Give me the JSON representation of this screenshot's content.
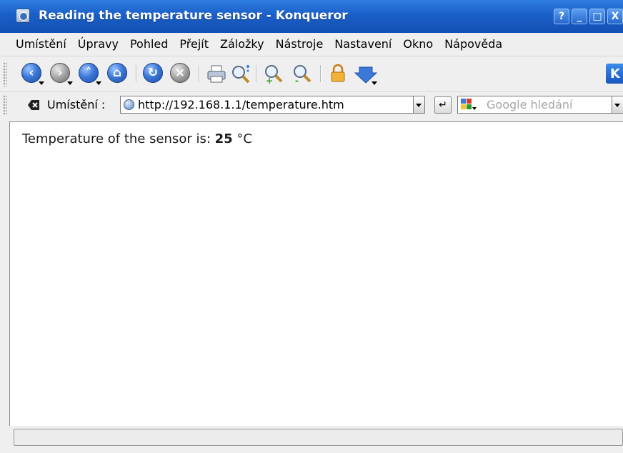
{
  "window": {
    "title": "Reading the temperature sensor - Konqueror",
    "buttons": {
      "help": "?",
      "minimize": "_",
      "maximize": "□",
      "close": "X"
    }
  },
  "menubar": {
    "items": [
      "Umístění",
      "Úpravy",
      "Pohled",
      "Přejít",
      "Záložky",
      "Nástroje",
      "Nastavení",
      "Okno",
      "Nápověda"
    ]
  },
  "toolbar": {
    "icons": [
      "back-icon",
      "forward-icon",
      "up-icon",
      "home-icon",
      "reload-icon",
      "stop-icon",
      "print-icon",
      "find-icon",
      "zoom-in-icon",
      "zoom-out-icon",
      "lock-icon",
      "download-icon",
      "kde-logo"
    ]
  },
  "location": {
    "label": "Umístění :",
    "url": "http://192.168.1.1/temperature.htm",
    "search_placeholder": "Google hledání"
  },
  "page": {
    "prefix": "Temperature of the sensor is: ",
    "value": "25",
    "unit": " °C"
  },
  "colors": {
    "titlebar": "#1a5fc8",
    "chrome": "#efefef",
    "content": "#ffffff"
  }
}
